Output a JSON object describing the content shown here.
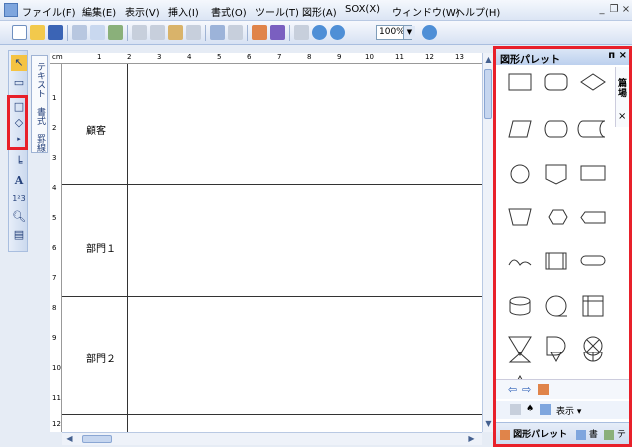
{
  "menu": {
    "items": [
      "ファイル(F)",
      "編集(E)",
      "表示(V)",
      "挿入(I)",
      "書式(O)",
      "ツール(T)",
      "図形(A)",
      "SOX(X)",
      "ウィンドウ(W)",
      "ヘルプ(H)"
    ]
  },
  "toolbar": {
    "zoom": "100%"
  },
  "sidetab": {
    "label": "テキスト　書式　罫線"
  },
  "ruler": {
    "unit": "cm",
    "top_ticks": [
      "1",
      "2",
      "3",
      "4",
      "5",
      "6",
      "7",
      "8",
      "9",
      "10",
      "11",
      "12",
      "13"
    ],
    "left_ticks": [
      "1",
      "2",
      "3",
      "4",
      "5",
      "6",
      "7",
      "8",
      "9",
      "10",
      "11",
      "12"
    ]
  },
  "lanes": [
    "顧客",
    "部門１",
    "部門２"
  ],
  "palette": {
    "title": "図形パレット",
    "side_label": "篇\n場",
    "bar2_label": "表示 ▾",
    "tabs": [
      "図形パレット",
      "書",
      "テ"
    ]
  },
  "colors": {
    "highlight": "#e8202a",
    "accent": "#7fa6de"
  }
}
